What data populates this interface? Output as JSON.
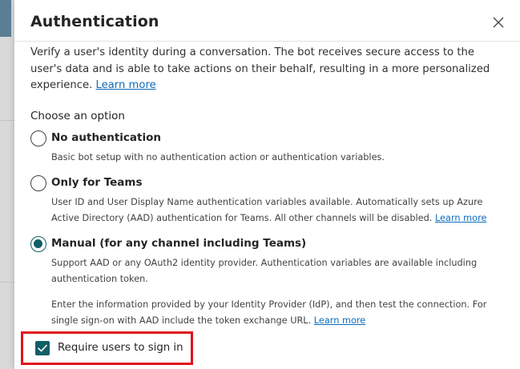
{
  "panel": {
    "title": "Authentication",
    "description": "Verify a user's identity during a conversation. The bot receives secure access to the user's data and is able to take actions on their behalf, resulting in a more personalized experience.",
    "learn_more": "Learn more"
  },
  "choose_label": "Choose an option",
  "options": [
    {
      "label": "No authentication",
      "description": "Basic bot setup with no authentication action or authentication variables.",
      "link": "",
      "checked": false
    },
    {
      "label": "Only for Teams",
      "description": "User ID and User Display Name authentication variables available. Automatically sets up Azure Active Directory (AAD) authentication for Teams. All other channels will be disabled.",
      "link": "Learn more",
      "checked": false
    },
    {
      "label": "Manual (for any channel including Teams)",
      "description": "Support AAD or any OAuth2 identity provider. Authentication variables are available including authentication token.",
      "link": "",
      "checked": true
    }
  ],
  "manual_info": {
    "text": "Enter the information provided by your Identity Provider (IdP), and then test the connection. For single sign-on with AAD include the token exchange URL.",
    "link": "Learn more"
  },
  "require_signin": {
    "label": "Require users to sign in",
    "checked": true
  },
  "colors": {
    "accent": "#115e67",
    "link": "#0f6cbd",
    "highlight": "#e0131d"
  },
  "icons": {
    "close": "close-icon",
    "check": "checkmark-icon"
  }
}
